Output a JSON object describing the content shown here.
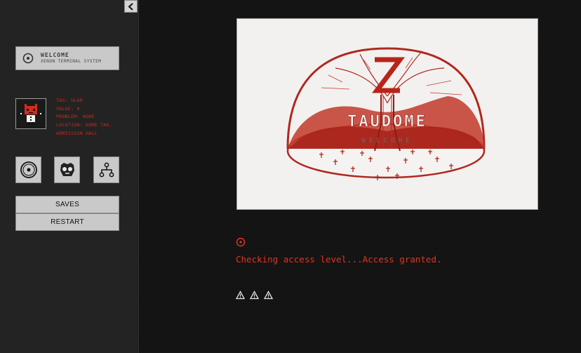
{
  "sidebar": {
    "collapse_icon": "chevron-left-icon",
    "logo": {
      "icon": "ring-icon",
      "title": "WELCOME",
      "subtitle": "XENON TERMINAL SYSTEM"
    },
    "profile": {
      "avatar_icon": "red-devil-avatar",
      "lines": [
        "TAG: ULAR",
        "VALUE: 0",
        "PROBLEM: NONE",
        "LOCATION: DOME TAU,",
        "ADMISSION HALL"
      ]
    },
    "icon_buttons": [
      "disc-icon",
      "skull-mask-icon",
      "network-tree-icon"
    ],
    "buttons": {
      "saves": "SAVES",
      "restart": "RESTART"
    }
  },
  "main": {
    "image": {
      "description_icon": "dome-tree-emblem",
      "glyph_banner": "TAUDOME",
      "welcome_text": "WELCOME"
    },
    "status_icon": "target-circle-icon",
    "status_text": "Checking access level...Access granted.",
    "warning_icons": [
      "warning-triangle-icon",
      "warning-triangle-icon",
      "warning-triangle-icon"
    ]
  },
  "colors": {
    "accent_red": "#e03422",
    "info_red": "#cc2a1e",
    "sidebar_bg": "#232323",
    "button_bg": "#c9c9c9",
    "page_bg": "#121212"
  }
}
